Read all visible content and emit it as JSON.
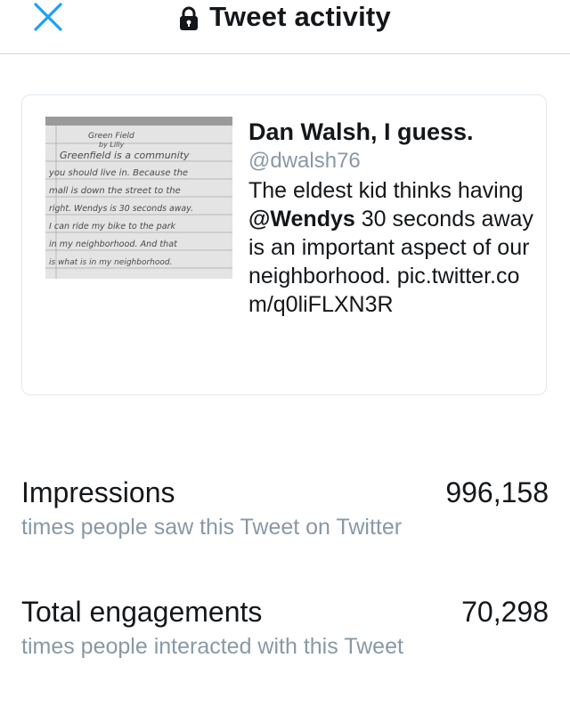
{
  "header": {
    "title": "Tweet activity",
    "close_icon": "close-icon",
    "lock_icon": "lock-icon"
  },
  "tweet": {
    "author_name": "Dan Walsh, I guess.",
    "author_handle": "@dwalsh76",
    "text_before": "The eldest kid thinks having ",
    "mention": "@Wendys",
    "text_after": " 30 seconds away is an important aspect of our neighborhood. pic.twitter.com/q0liFLXN3R",
    "image": {
      "lines": [
        "Green Field",
        "by Lilly",
        "Greenfield is a community",
        "you should live in. Because the",
        "mall is down the street to the",
        "right. Wendys is 30 seconds away.",
        "I can ride my bike to the park",
        "in my neighborhood. And that",
        "is what is in my neighborhood."
      ]
    }
  },
  "metrics": [
    {
      "label": "Impressions",
      "value": "996,158",
      "description": "times people saw this Tweet on Twitter"
    },
    {
      "label": "Total engagements",
      "value": "70,298",
      "description": "times people interacted with this Tweet"
    }
  ],
  "colors": {
    "accent": "#1da1f2",
    "secondary_text": "#8899a6",
    "primary_text": "#14171a"
  }
}
